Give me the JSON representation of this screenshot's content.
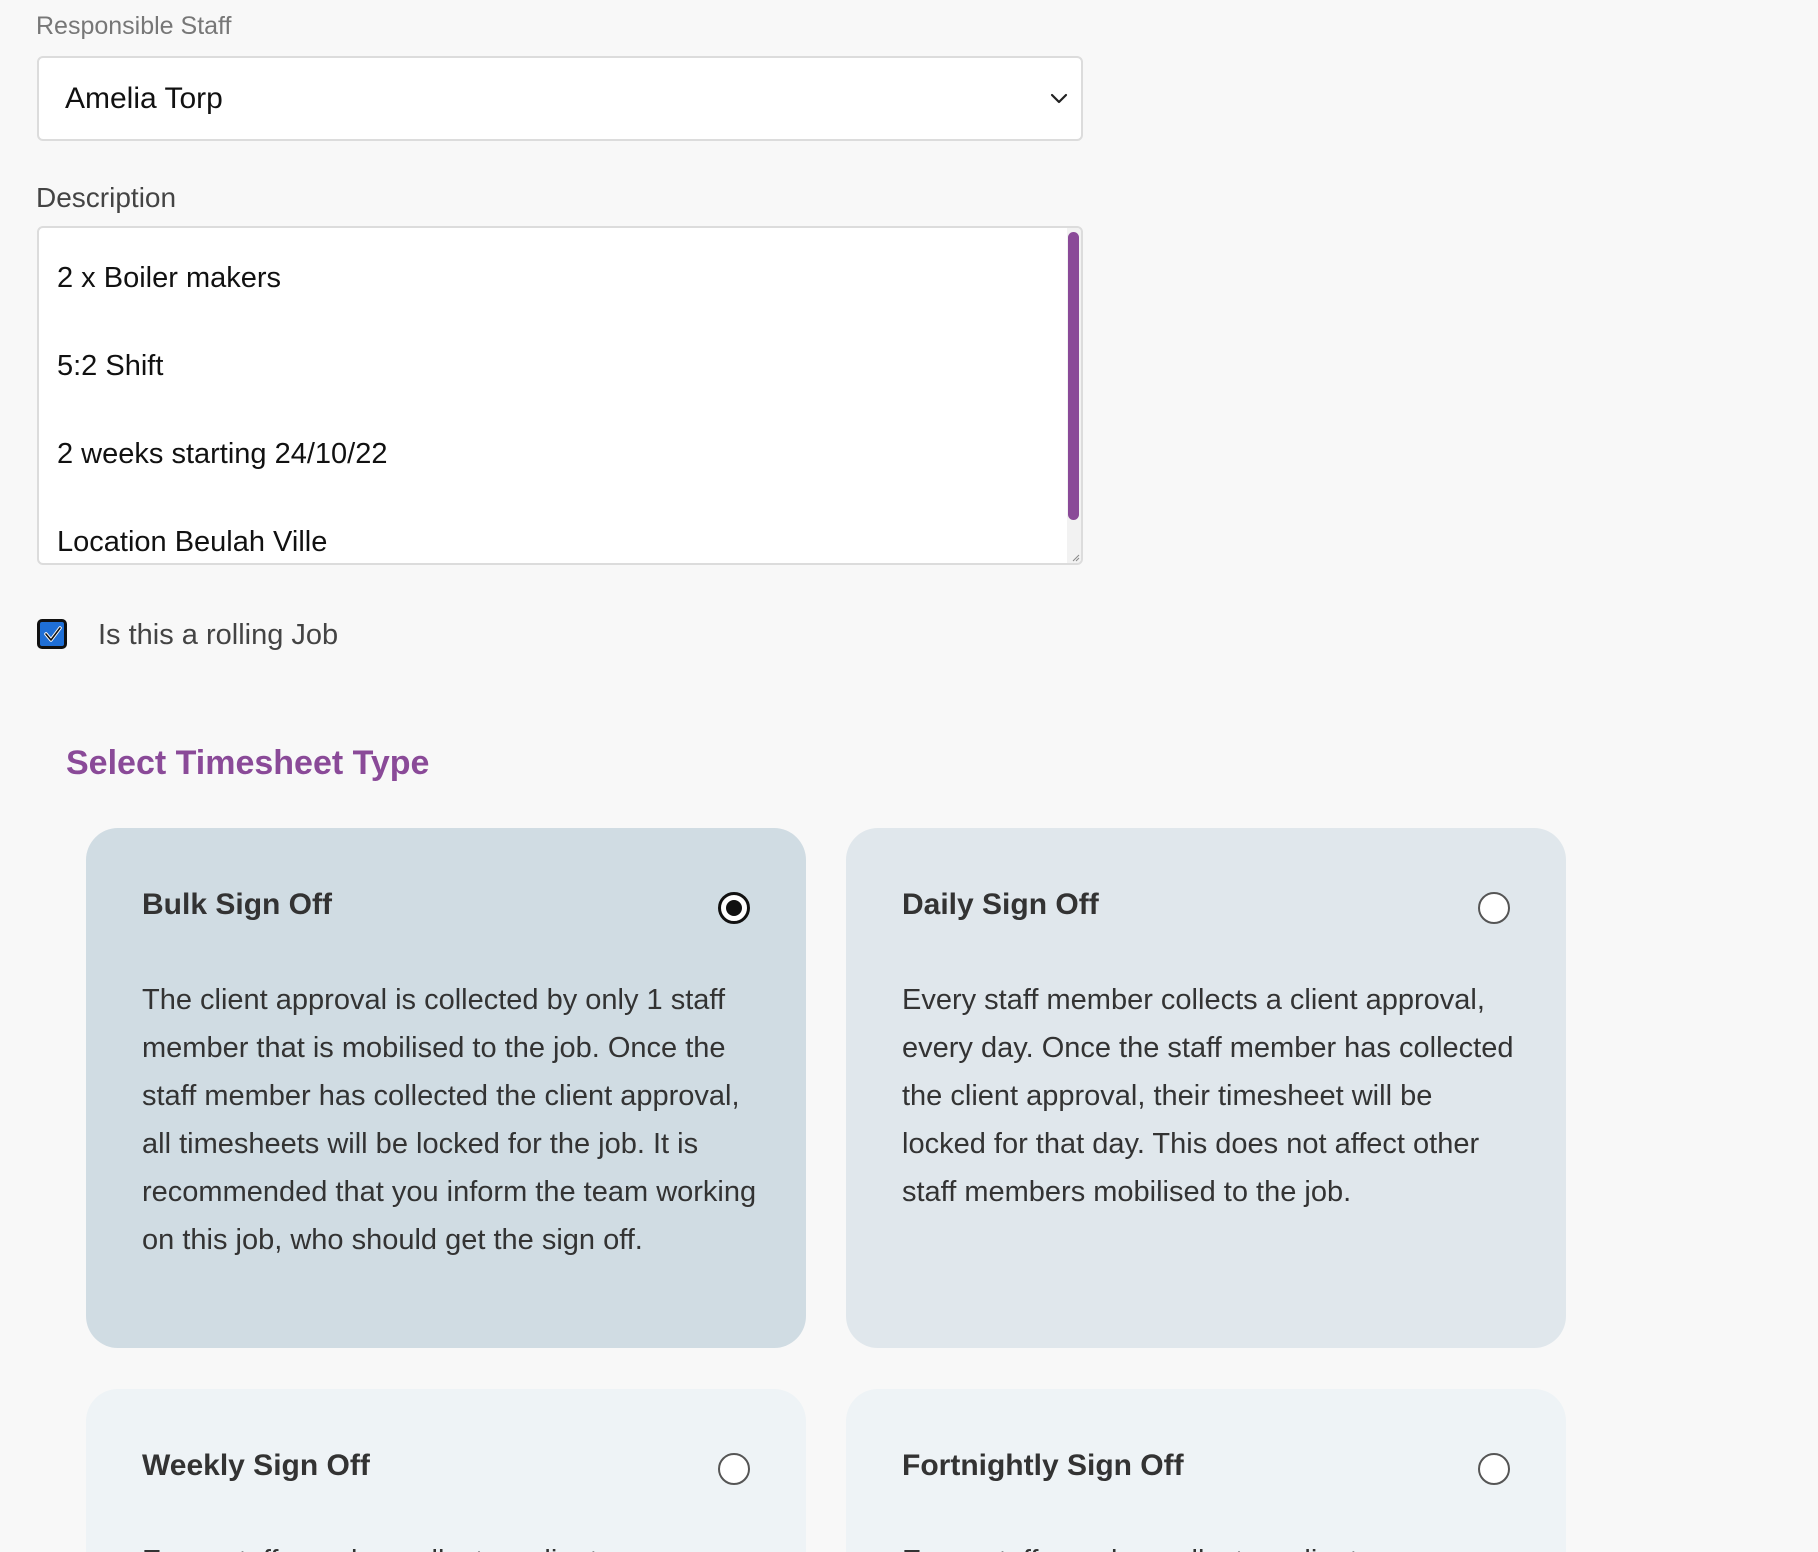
{
  "responsible_staff": {
    "label": "Responsible Staff",
    "selected": "Amelia Torp"
  },
  "description": {
    "label": "Description",
    "lines": [
      "2 x Boiler makers",
      "5:2 Shift",
      "2 weeks starting 24/10/22",
      "Location Beulah Ville"
    ]
  },
  "rolling_job": {
    "label": "Is this a rolling Job",
    "checked": true
  },
  "timesheet": {
    "title": "Select Timesheet Type",
    "options": [
      {
        "title": "Bulk Sign Off",
        "selected": true,
        "description": "The client approval is collected by only 1 staff member that is mobilised to the job. Once the staff member has collected the client approval, all timesheets will be locked for the job. It is recommended that you inform the team working on this job, who should get the sign off."
      },
      {
        "title": "Daily Sign Off",
        "selected": false,
        "description": "Every staff member collects a client approval, every day. Once the staff member has collected the client approval, their timesheet will be locked for that day. This does not affect other staff members mobilised to the job."
      },
      {
        "title": "Weekly Sign Off",
        "selected": false,
        "description": "Every staff member collects a client"
      },
      {
        "title": "Fortnightly Sign Off",
        "selected": false,
        "description": "Every staff member collects a client"
      }
    ]
  },
  "colors": {
    "accent": "#8a4a98",
    "selected_card": "#d0dce3",
    "card": "#e0e7ec",
    "checkbox": "#1f6fd6"
  }
}
